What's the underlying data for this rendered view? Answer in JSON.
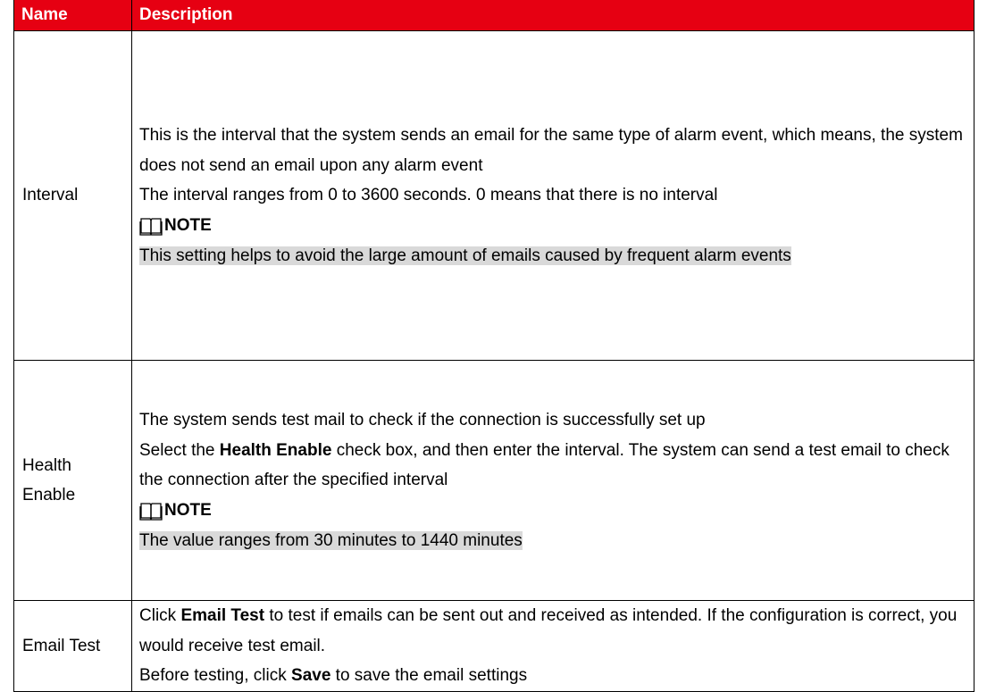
{
  "table": {
    "headers": {
      "name": "Name",
      "description": "Description"
    },
    "rows": [
      {
        "name": "Interval",
        "paragraphs": [
          "This is the interval that the system sends an email for the same type of alarm event, which means, the system does not send an email upon any alarm event",
          "The interval ranges from 0 to 3600 seconds. 0 means that there is no interval"
        ],
        "note": {
          "label": "NOTE",
          "text": "This setting helps to avoid the large amount of emails caused by frequent alarm events"
        }
      },
      {
        "name": "Health Enable",
        "paragraphs": [
          "The system sends test mail to check if the connection is successfully set up"
        ],
        "p2": {
          "pre": "Select the ",
          "bold": "Health Enable",
          "post": " check box, and then enter the interval. The system can send a test email to check the connection after the specified interval"
        },
        "note": {
          "label": "NOTE",
          "text": "The value ranges from 30 minutes to 1440 minutes"
        }
      },
      {
        "name": "Email Test",
        "p1": {
          "pre": "Click ",
          "bold": "Email Test",
          "post": " to test if emails can be sent out and received as intended. If the configuration is correct, you would receive test email."
        },
        "p2": {
          "pre": "Before testing, click ",
          "bold": "Save",
          "post": " to save the email settings"
        }
      }
    ]
  },
  "colors": {
    "header_bg": "#e60012",
    "header_text": "#ffffff",
    "note_highlight": "#d9d9d9"
  },
  "icons": {
    "note": "book-icon"
  }
}
